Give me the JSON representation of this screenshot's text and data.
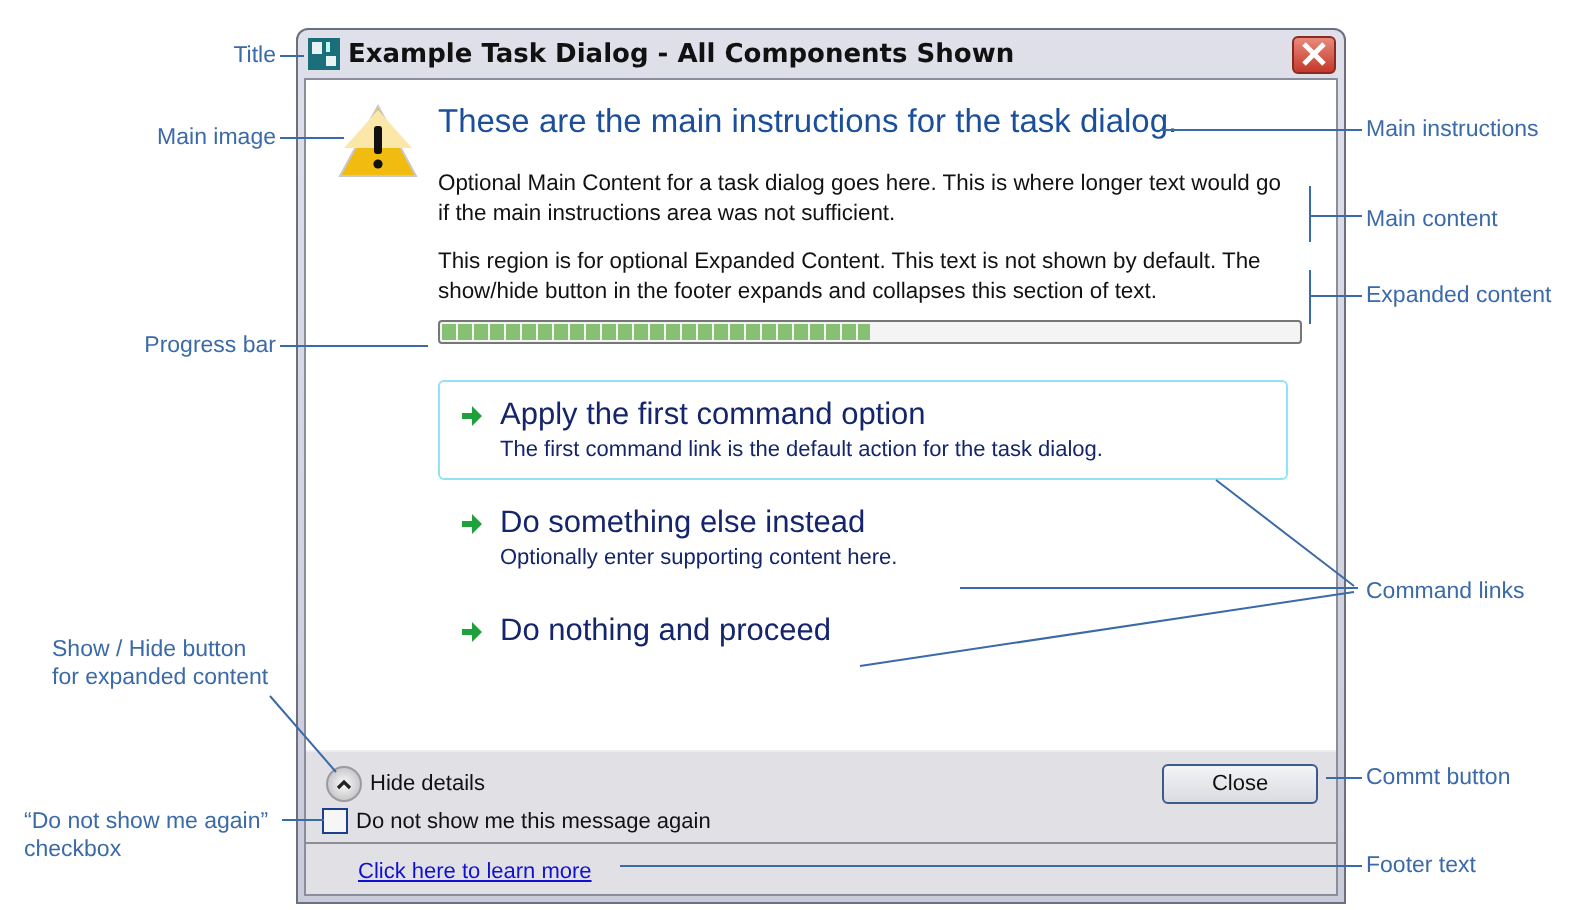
{
  "annotations": [
    {
      "text": "Title"
    },
    {
      "text": "Main image"
    },
    {
      "text": "Main instructions"
    },
    {
      "text": "Main content"
    },
    {
      "text": "Expanded content"
    },
    {
      "text": "Progress bar"
    },
    {
      "text": "Command links"
    },
    {
      "text": "Show / Hide button\nfor expanded content"
    },
    {
      "text": "Commt button"
    },
    {
      "text": "“Do not show me again”\ncheckbox"
    },
    {
      "text": "Footer text"
    }
  ],
  "dialog": {
    "title": "Example Task Dialog - All Components Shown",
    "main_instruction": "These are the main instructions for the task dialog.",
    "content": "Optional Main Content for a task dialog goes here. This is where longer text would go if the main instructions area was not sufficient.",
    "expanded_content": "This region is for optional Expanded Content. This text is not shown by default. The show/hide button in the footer expands and collapses this section of text.",
    "progress": {
      "level": 0.5
    },
    "command_links": [
      {
        "title": "Apply the first command option",
        "note": "The first command link is the default action for the task dialog.",
        "selected": true
      },
      {
        "title": "Do something else instead",
        "note": "Optionally enter supporting content here.",
        "selected": false
      },
      {
        "title": "Do nothing and proceed",
        "selected": false
      }
    ],
    "expand_button": {
      "label": "Hide details",
      "expanded": true
    },
    "checkbox": {
      "label": "Do not show me this message again",
      "checked": false
    },
    "buttons": [
      "Close"
    ],
    "footer_link": "Click here to learn more"
  }
}
